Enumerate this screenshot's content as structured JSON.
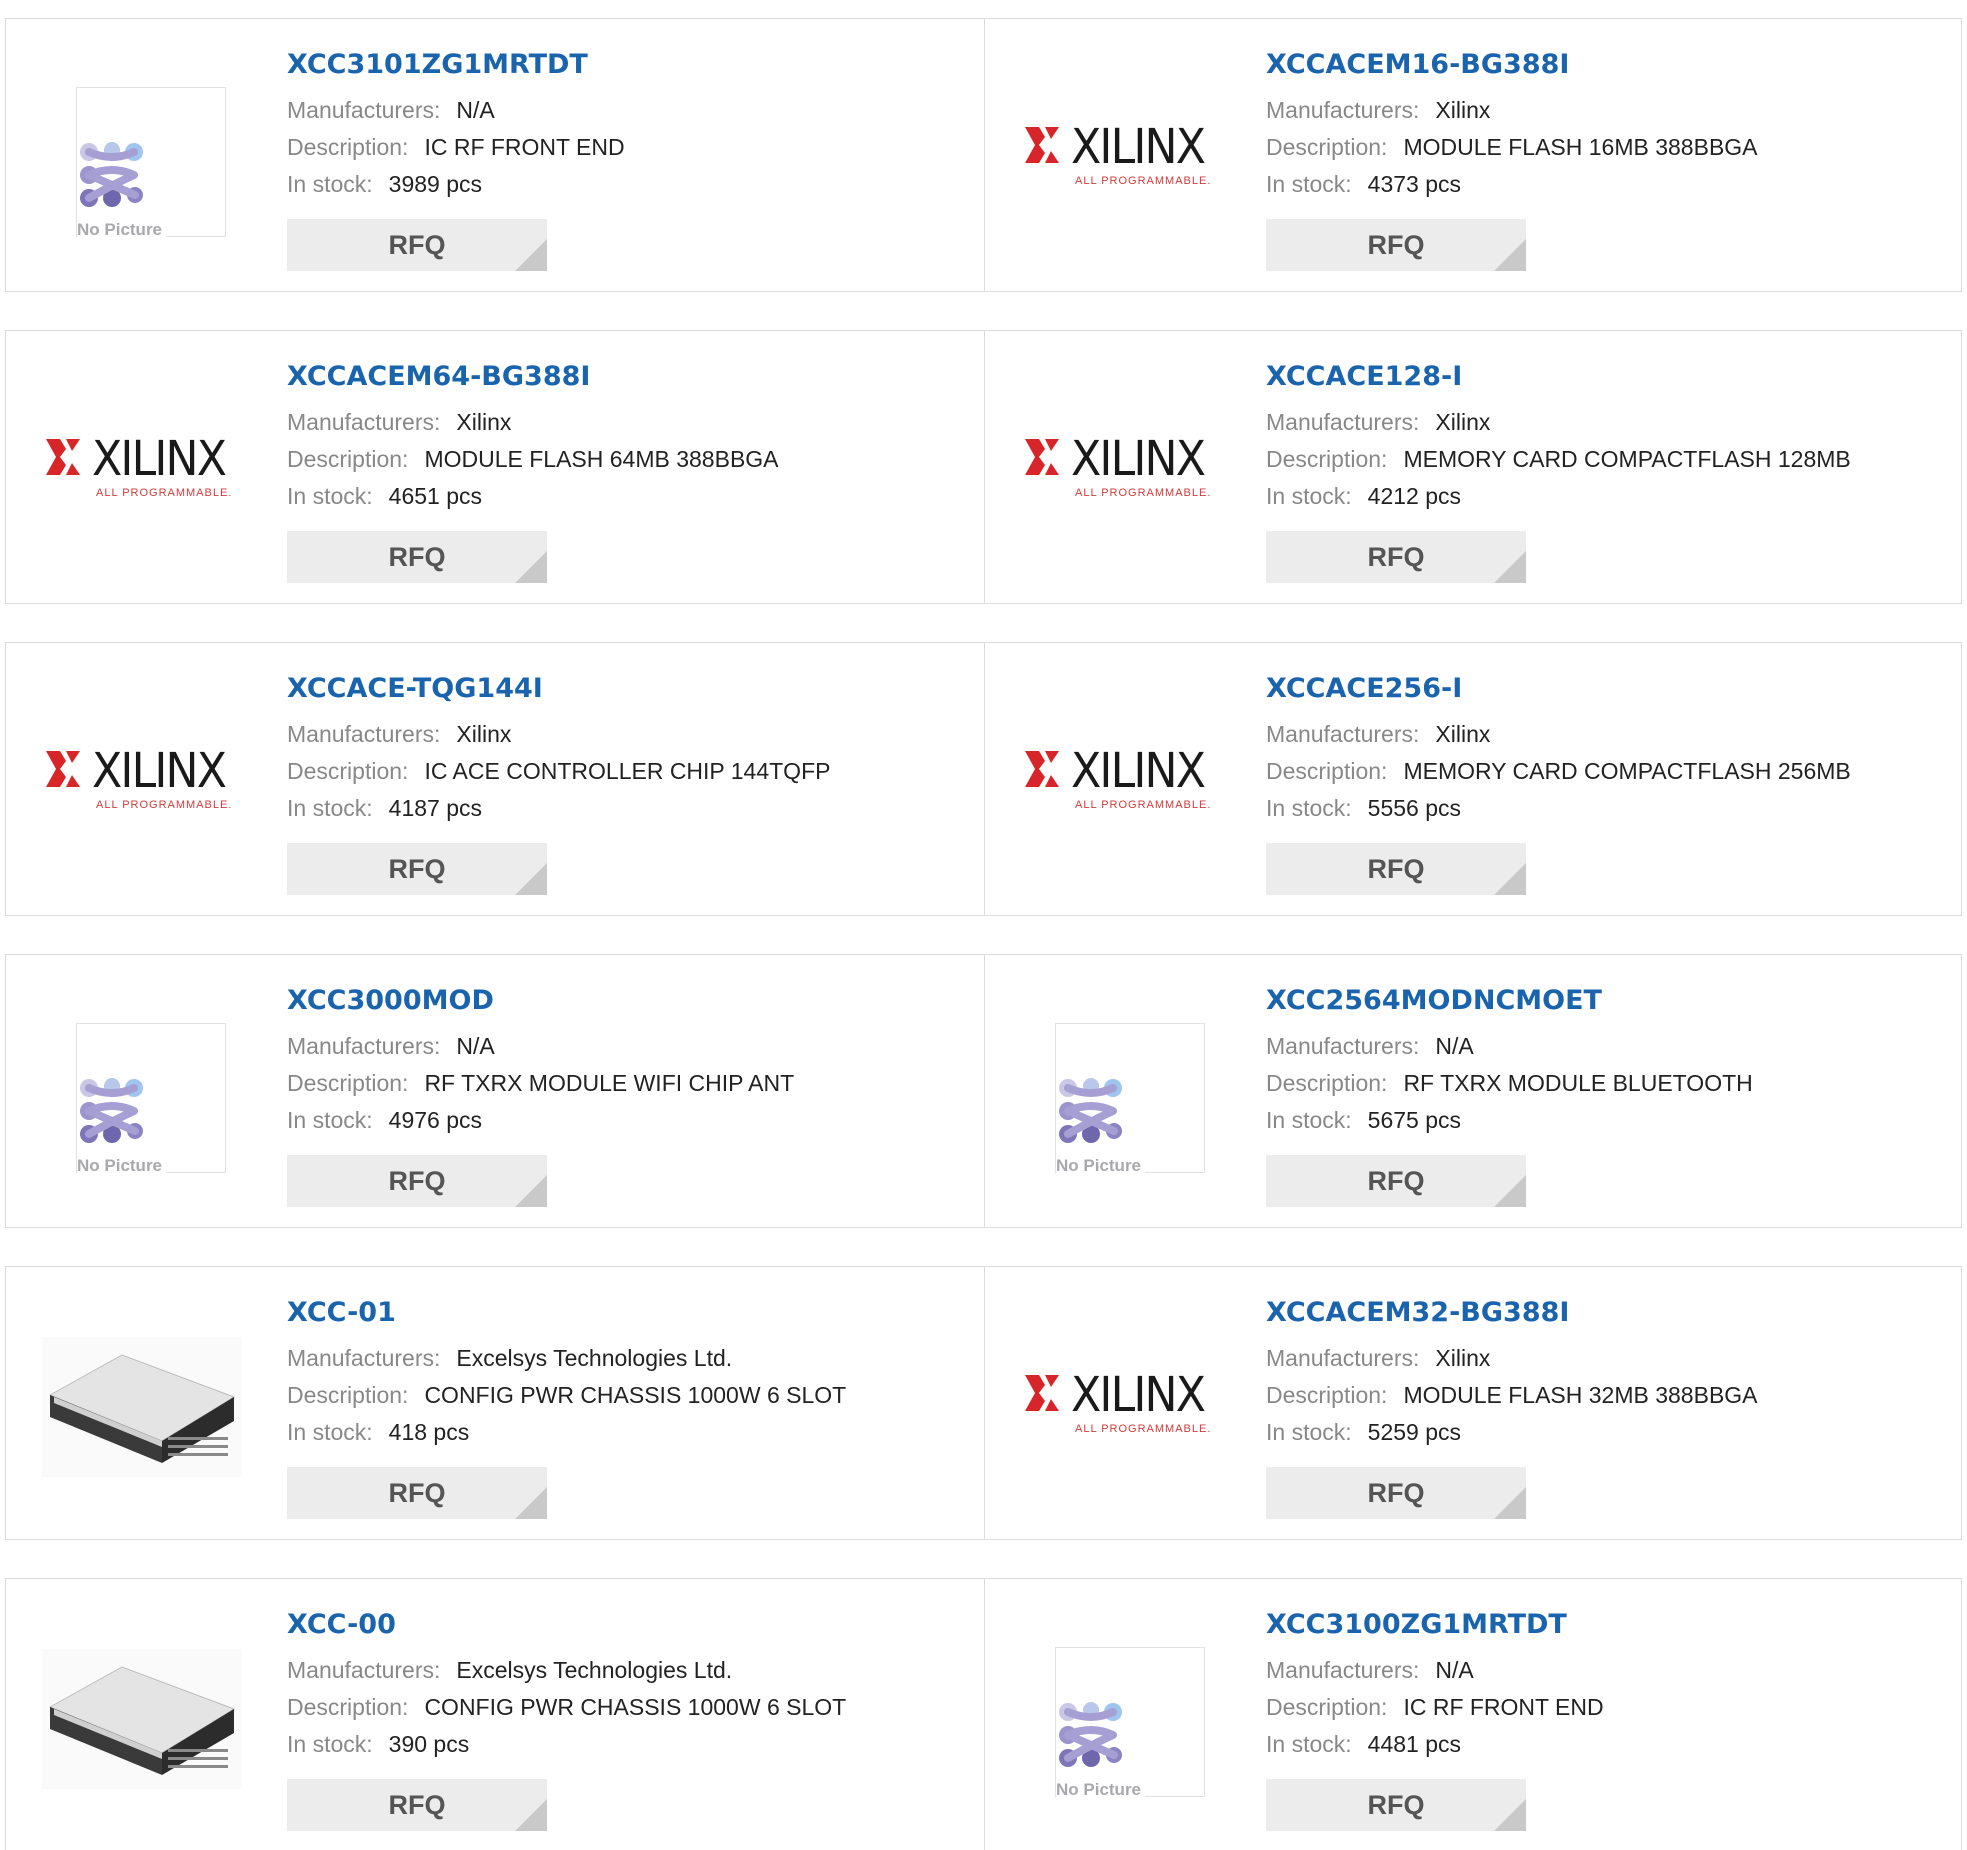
{
  "labels": {
    "manufacturers": "Manufacturers:",
    "description": "Description:",
    "in_stock": "In stock:",
    "rfq": "RFQ",
    "no_picture": "No Picture",
    "xilinx": "XILINX",
    "xilinx_tag": "ALL PROGRAMMABLE."
  },
  "colors": {
    "link": "#1a63ad",
    "xilinx_red": "#d8252a",
    "rfq_bg": "#ececec"
  },
  "products": [
    {
      "part": "XCC3101ZG1MRTDT",
      "manufacturer": "N/A",
      "description": "IC RF FRONT END",
      "stock": "3989 pcs",
      "image": "no-picture"
    },
    {
      "part": "XCCACEM16-BG388I",
      "manufacturer": "Xilinx",
      "description": "MODULE FLASH 16MB 388BBGA",
      "stock": "4373 pcs",
      "image": "xilinx-logo"
    },
    {
      "part": "XCCACEM64-BG388I",
      "manufacturer": "Xilinx",
      "description": "MODULE FLASH 64MB 388BBGA",
      "stock": "4651 pcs",
      "image": "xilinx-logo"
    },
    {
      "part": "XCCACE128-I",
      "manufacturer": "Xilinx",
      "description": "MEMORY CARD COMPACTFLASH 128MB",
      "stock": "4212 pcs",
      "image": "xilinx-logo"
    },
    {
      "part": "XCCACE-TQG144I",
      "manufacturer": "Xilinx",
      "description": "IC ACE CONTROLLER CHIP 144TQFP",
      "stock": "4187 pcs",
      "image": "xilinx-logo"
    },
    {
      "part": "XCCACE256-I",
      "manufacturer": "Xilinx",
      "description": "MEMORY CARD COMPACTFLASH 256MB",
      "stock": "5556 pcs",
      "image": "xilinx-logo"
    },
    {
      "part": "XCC3000MOD",
      "manufacturer": "N/A",
      "description": "RF TXRX MODULE WIFI CHIP ANT",
      "stock": "4976 pcs",
      "image": "no-picture"
    },
    {
      "part": "XCC2564MODNCMOET",
      "manufacturer": "N/A",
      "description": "RF TXRX MODULE BLUETOOTH",
      "stock": "5675 pcs",
      "image": "no-picture"
    },
    {
      "part": "XCC-01",
      "manufacturer": "Excelsys Technologies Ltd.",
      "description": "CONFIG PWR CHASSIS 1000W 6 SLOT",
      "stock": "418 pcs",
      "image": "chassis-photo"
    },
    {
      "part": "XCCACEM32-BG388I",
      "manufacturer": "Xilinx",
      "description": "MODULE FLASH 32MB 388BBGA",
      "stock": "5259 pcs",
      "image": "xilinx-logo"
    },
    {
      "part": "XCC-00",
      "manufacturer": "Excelsys Technologies Ltd.",
      "description": "CONFIG PWR CHASSIS 1000W 6 SLOT",
      "stock": "390 pcs",
      "image": "chassis-photo"
    },
    {
      "part": "XCC3100ZG1MRTDT",
      "manufacturer": "N/A",
      "description": "IC RF FRONT END",
      "stock": "4481 pcs",
      "image": "no-picture"
    }
  ]
}
